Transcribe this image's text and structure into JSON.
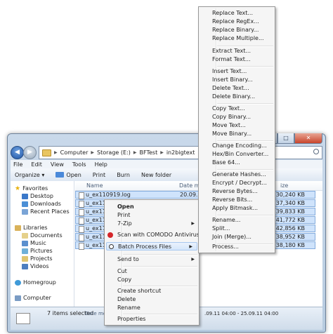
{
  "window": {
    "address": {
      "crumbs": [
        "Computer",
        "Storage (E:)",
        "BFTest",
        "in2bigtext"
      ]
    },
    "menubar": [
      "File",
      "Edit",
      "View",
      "Tools",
      "Help"
    ],
    "toolbar": {
      "organize": "Organize ▾",
      "open": "Open",
      "print": "Print",
      "burn": "Burn",
      "new_folder": "New folder"
    },
    "nav": {
      "favorites": "Favorites",
      "desktop": "Desktop",
      "downloads": "Downloads",
      "recent": "Recent Places",
      "libraries": "Libraries",
      "documents": "Documents",
      "music": "Music",
      "pictures": "Pictures",
      "projects": "Projects",
      "videos": "Videos",
      "homegroup": "Homegroup",
      "computer": "Computer"
    },
    "columns": {
      "name": "Name",
      "date": "Date m",
      "size": "ize"
    },
    "files": [
      {
        "name": "u_ex110919.log",
        "date": "20.09.11",
        "size": "30,240 KB"
      },
      {
        "name": "u_ex110",
        "date": "",
        "size": "37,340 KB"
      },
      {
        "name": "u_ex110",
        "date": "",
        "size": "39,833 KB"
      },
      {
        "name": "u_ex110",
        "date": "",
        "size": "41,772 KB"
      },
      {
        "name": "u_ex110",
        "date": "",
        "size": "42,856 KB"
      },
      {
        "name": "u_ex110",
        "date": "",
        "size": "38,952 KB"
      },
      {
        "name": "u_ex110",
        "date": "",
        "size": "38,180 KB"
      }
    ],
    "status": {
      "selected": "7 items selected",
      "date_label": "Date modifi",
      "date_range": ".09.11 04:00 - 25.09.11 04:00"
    }
  },
  "context_menu": {
    "items": {
      "open": "Open",
      "print": "Print",
      "zip": "7-Zip",
      "comodo": "Scan with COMODO Antivirus",
      "batch": "Batch Process Files",
      "sendto": "Send to",
      "cut": "Cut",
      "copy": "Copy",
      "shortcut": "Create shortcut",
      "delete": "Delete",
      "rename": "Rename",
      "properties": "Properties"
    }
  },
  "submenu": {
    "items": [
      "Replace Text...",
      "Replace RegEx...",
      "Replace Binary...",
      "Replace Multiple...",
      "Extract Text...",
      "Format Text...",
      "Insert Text...",
      "Insert Binary...",
      "Delete Text...",
      "Delete Binary...",
      "Copy Text...",
      "Copy Binary...",
      "Move Text...",
      "Move Binary...",
      "Change Encoding...",
      "Hex/Bin Converter...",
      "Base 64...",
      "Generate Hashes...",
      "Encrypt / Decrypt...",
      "Reverse Bytes...",
      "Reverse Bits...",
      "Apply Bitmask...",
      "Rename...",
      "Split...",
      "Join (Merge)...",
      "Process..."
    ]
  },
  "colors": {
    "selection": "#cfe3fb",
    "selection_border": "#84acdd",
    "window_frame": "#b7cbe0",
    "menu_bg": "#f5f5f5"
  }
}
